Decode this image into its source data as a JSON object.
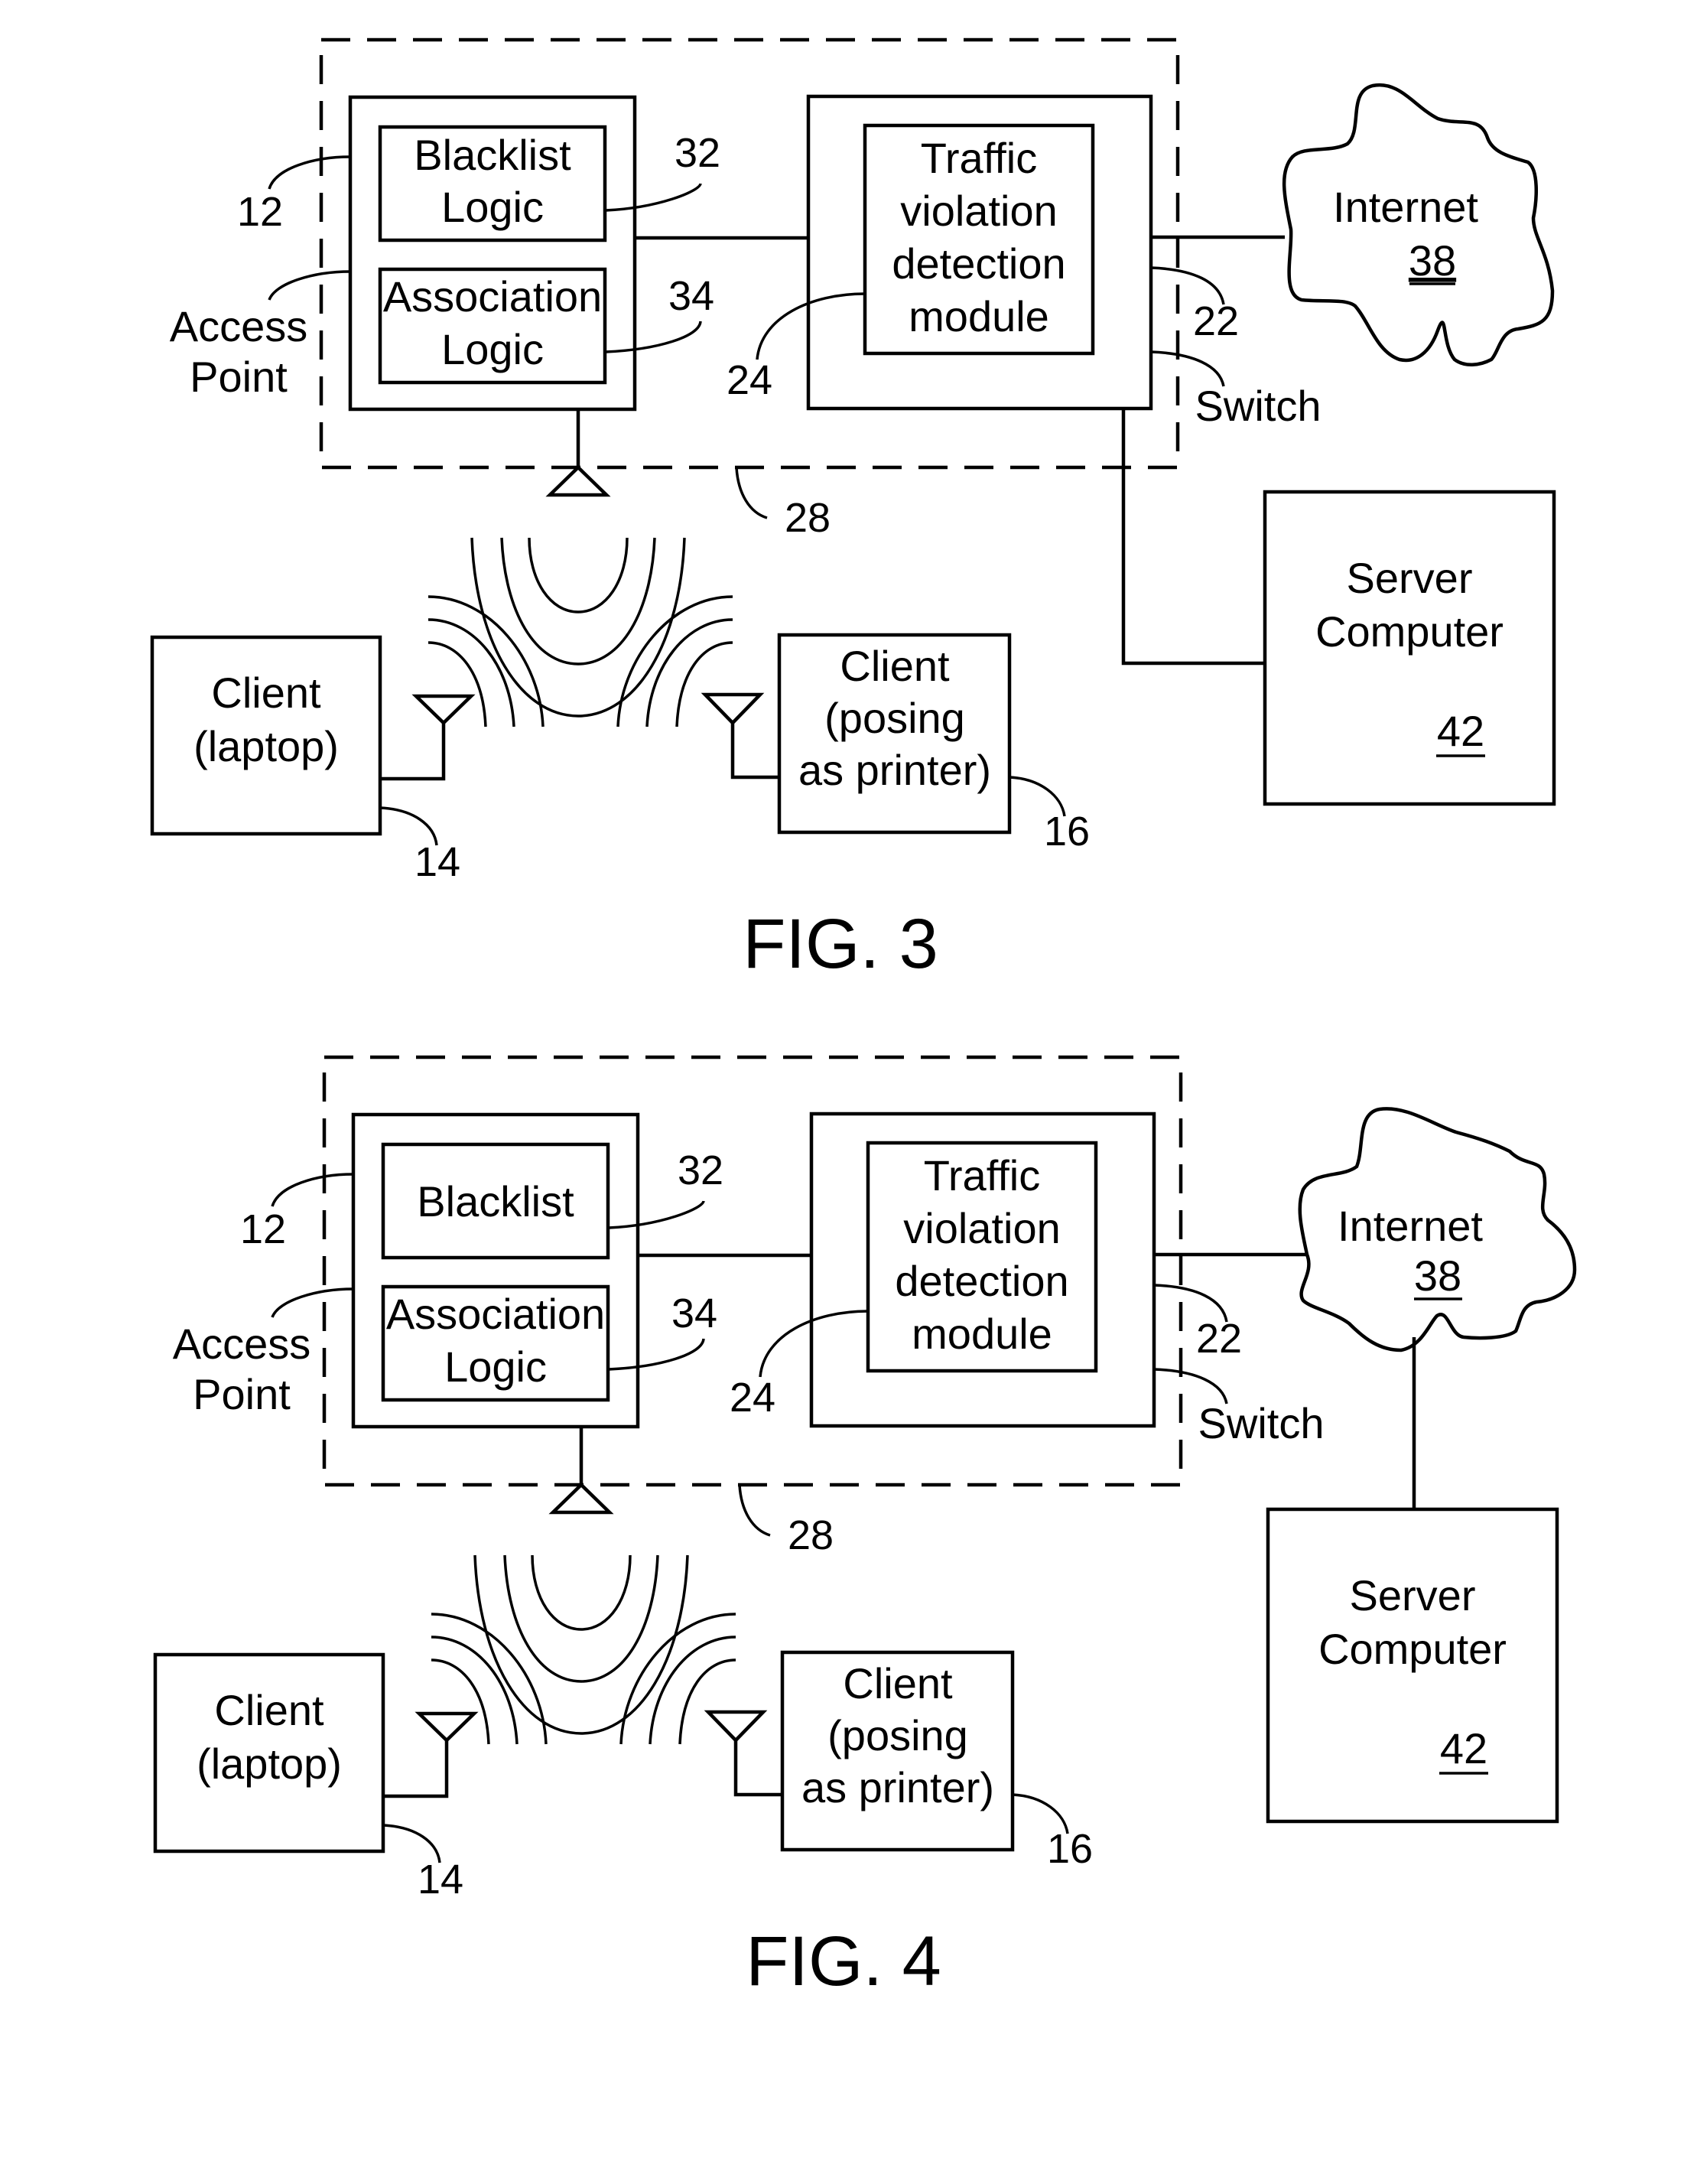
{
  "figures": [
    {
      "caption": "FIG. 3",
      "access_point": {
        "label_line1": "Access",
        "label_line2": "Point",
        "ref": "12",
        "blacklist": {
          "line1": "Blacklist",
          "line2": "Logic",
          "ref": "32"
        },
        "association": {
          "line1": "Association",
          "line2": "Logic",
          "ref": "34"
        }
      },
      "switch": {
        "label": "Switch",
        "ref": "22",
        "module": {
          "line1": "Traffic",
          "line2": "violation",
          "line3": "detection",
          "line4": "module",
          "ref": "24"
        }
      },
      "enclosure_ref": "28",
      "internet": {
        "label": "Internet",
        "ref": "38"
      },
      "server": {
        "line1": "Server",
        "line2": "Computer",
        "ref": "42",
        "connected_to": "switch"
      },
      "client_laptop": {
        "line1": "Client",
        "line2": "(laptop)",
        "ref": "14"
      },
      "client_printer": {
        "line1": "Client",
        "line2": "(posing",
        "line3": "as printer)",
        "ref": "16"
      }
    },
    {
      "caption": "FIG. 4",
      "access_point": {
        "label_line1": "Access",
        "label_line2": "Point",
        "ref": "12",
        "blacklist": {
          "line1": "Blacklist",
          "line2": "",
          "ref": "32"
        },
        "association": {
          "line1": "Association",
          "line2": "Logic",
          "ref": "34"
        }
      },
      "switch": {
        "label": "Switch",
        "ref": "22",
        "module": {
          "line1": "Traffic",
          "line2": "violation",
          "line3": "detection",
          "line4": "module",
          "ref": "24"
        }
      },
      "enclosure_ref": "28",
      "internet": {
        "label": "Internet",
        "ref": "38"
      },
      "server": {
        "line1": "Server",
        "line2": "Computer",
        "ref": "42",
        "connected_to": "internet"
      },
      "client_laptop": {
        "line1": "Client",
        "line2": "(laptop)",
        "ref": "14"
      },
      "client_printer": {
        "line1": "Client",
        "line2": "(posing",
        "line3": "as printer)",
        "ref": "16"
      }
    }
  ]
}
